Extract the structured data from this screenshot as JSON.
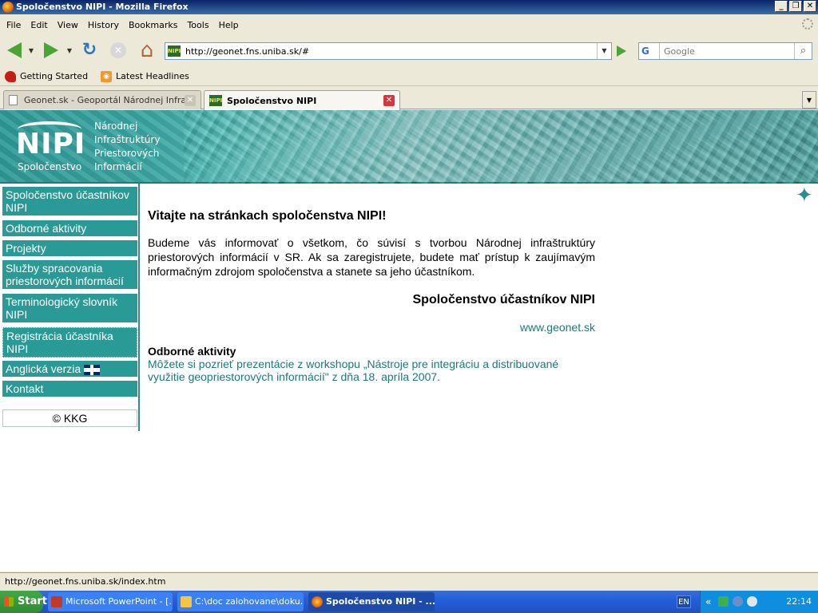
{
  "window": {
    "title": "Spoločenstvo NIPI - Mozilla Firefox",
    "minimize": "_",
    "restore": "❐",
    "close": "✕"
  },
  "menu": [
    "File",
    "Edit",
    "View",
    "History",
    "Bookmarks",
    "Tools",
    "Help"
  ],
  "navbar": {
    "url": "http://geonet.fns.uniba.sk/#",
    "search_engine": "G",
    "search_placeholder": "Google"
  },
  "bookmarks": [
    {
      "label": "Getting Started",
      "icon": "firefox-bookmark-icon"
    },
    {
      "label": "Latest Headlines",
      "icon": "rss-icon"
    }
  ],
  "tabs": [
    {
      "label": "Geonet.sk - Geoportál Národnej Infra...",
      "active": false
    },
    {
      "label": "Spoločenstvo NIPI",
      "active": true
    }
  ],
  "banner": {
    "logo": "NIPI",
    "logo_sub": "Spoločenstvo",
    "lines": [
      "Národnej",
      "Infraštruktúry",
      "Priestorových",
      "Informácií"
    ]
  },
  "sidebar": {
    "items": [
      "Spoločenstvo účastníkov NIPI",
      "Odborné aktivity",
      "Projekty",
      "Služby spracovania priestorových informácií",
      "Terminologický slovník NIPI",
      "Registrácia účastníka NIPI",
      "Anglická verzia",
      "Kontakt"
    ],
    "footer": "© KKG"
  },
  "content": {
    "welcome": "Vitajte na stránkach spoločenstva NIPI!",
    "intro": "Budeme vás informovať o všetkom, čo súvisí s tvorbou Národnej infraštruktúry priestorových informácií v SR. Ak sa zaregistrujete, budete mať prístup k zaujímavým informačným zdrojom spoločenstva a stanete sa jeho účastníkom.",
    "org": "Spoločenstvo účastníkov NIPI",
    "link": "www.geonet.sk",
    "section_title": "Odborné aktivity",
    "section_text": "Môžete si pozrieť prezentácie z workshopu „Nástroje pre integráciu a distribuované využitie geopriestorových informácií\" z dňa 18. apríla 2007."
  },
  "status": "http://geonet.fns.uniba.sk/index.htm",
  "taskbar": {
    "start": "Start",
    "tasks": [
      "Microsoft PowerPoint - [...",
      "C:\\doc zalohovane\\doku...",
      "Spoločenstvo NIPI - ..."
    ],
    "lang": "EN",
    "clock": "22:14"
  }
}
